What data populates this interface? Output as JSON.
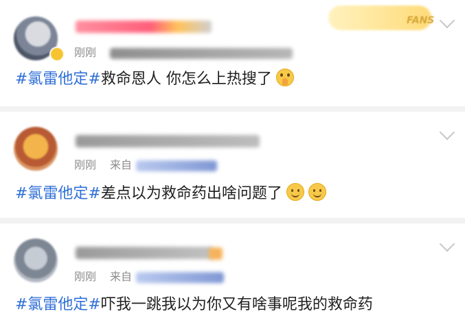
{
  "comments": [
    {
      "time": "刚刚",
      "badge": "FANS",
      "topic": "#氯雷他定#",
      "content": "救命恩人 你怎么上热搜了",
      "emoji": "face-with-pleading-hands-icon"
    },
    {
      "time": "刚刚",
      "source_label": "来自",
      "topic": "#氯雷他定#",
      "content": "差点以为救命药出啥问题了",
      "emoji": "smile-face-icon"
    },
    {
      "time": "刚刚",
      "source_label": "来自",
      "topic": "#氯雷他定#",
      "content": "吓我一跳我以为你又有啥事呢我的救命药"
    }
  ],
  "colors": {
    "topic": "#2f6fd7",
    "meta": "#8c8c8c",
    "separator": "#f2f2f2"
  }
}
